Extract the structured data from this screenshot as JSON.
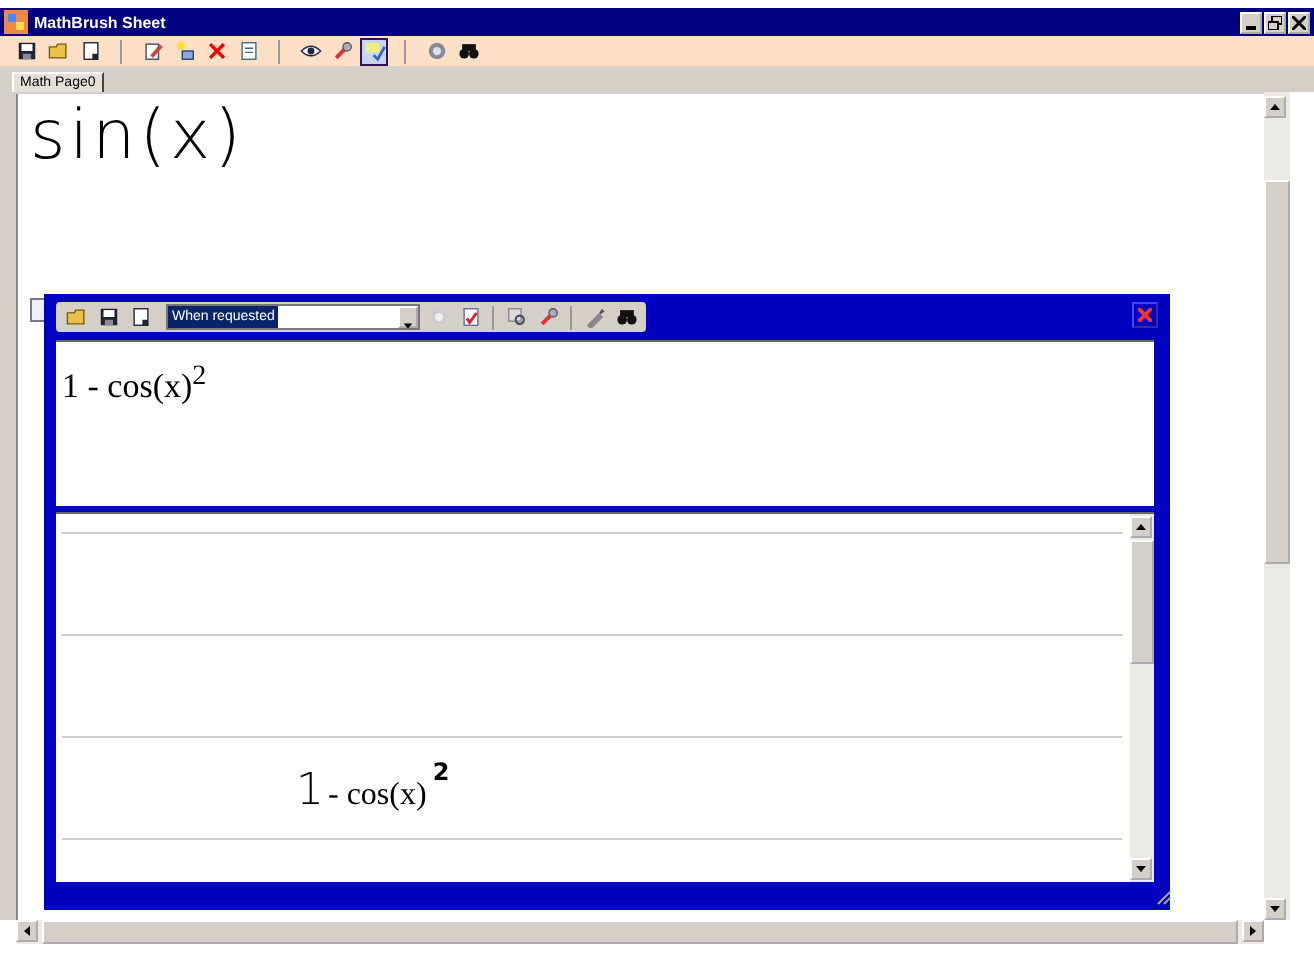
{
  "window": {
    "title": "MathBrush Sheet"
  },
  "toolbar": {
    "groups": [
      [
        {
          "pressed": false
        },
        {
          "pressed": false
        },
        {
          "pressed": false
        }
      ],
      [
        {
          "pressed": false
        },
        {
          "pressed": false
        },
        {
          "pressed": false
        },
        {
          "pressed": false
        }
      ],
      [
        {
          "pressed": false
        },
        {
          "pressed": false
        },
        {
          "pressed": true
        }
      ],
      [
        {
          "pressed": false
        },
        {
          "pressed": false
        }
      ]
    ]
  },
  "tabs": [
    {
      "label": "Math Page0",
      "selected": true
    }
  ],
  "page": {
    "handwriting": "sin(x)"
  },
  "panel": {
    "mode_combo": {
      "value": "When requested"
    },
    "input_expression": {
      "base": "1 - cos(x)",
      "exponent": "2"
    },
    "results": [
      {
        "lead": "1",
        "base": "- cos(x)",
        "exponent": "2"
      }
    ]
  }
}
